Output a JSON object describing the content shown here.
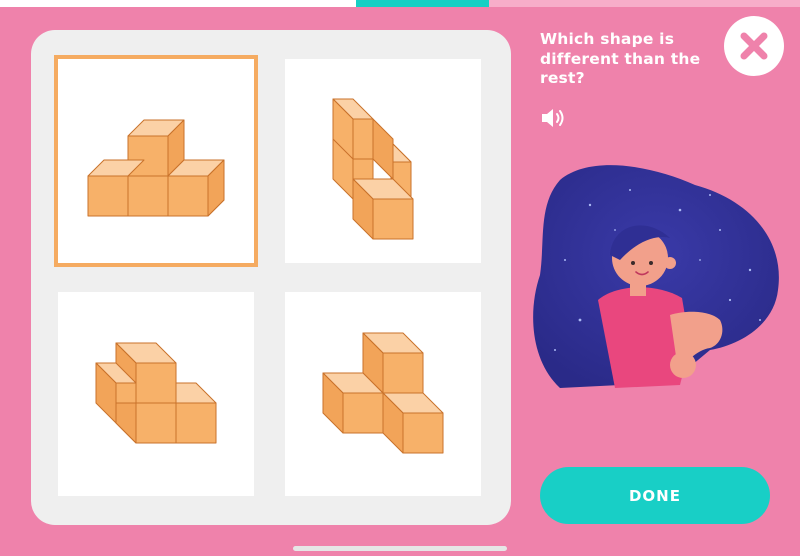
{
  "progress": {
    "completed_fraction": 0.445,
    "current_fraction": 0.166
  },
  "question": {
    "text": "Which shape is different than the rest?"
  },
  "icons": {
    "close": "close-icon",
    "speaker": "speaker-icon"
  },
  "options": [
    {
      "id": "shape-1",
      "selected": true
    },
    {
      "id": "shape-2",
      "selected": false
    },
    {
      "id": "shape-3",
      "selected": false
    },
    {
      "id": "shape-4",
      "selected": false
    }
  ],
  "buttons": {
    "done_label": "DONE"
  },
  "colors": {
    "background": "#ef82ab",
    "accent": "#18cfc6",
    "cube_fill": "#f7b169",
    "selection_outline": "#f5ab61"
  }
}
